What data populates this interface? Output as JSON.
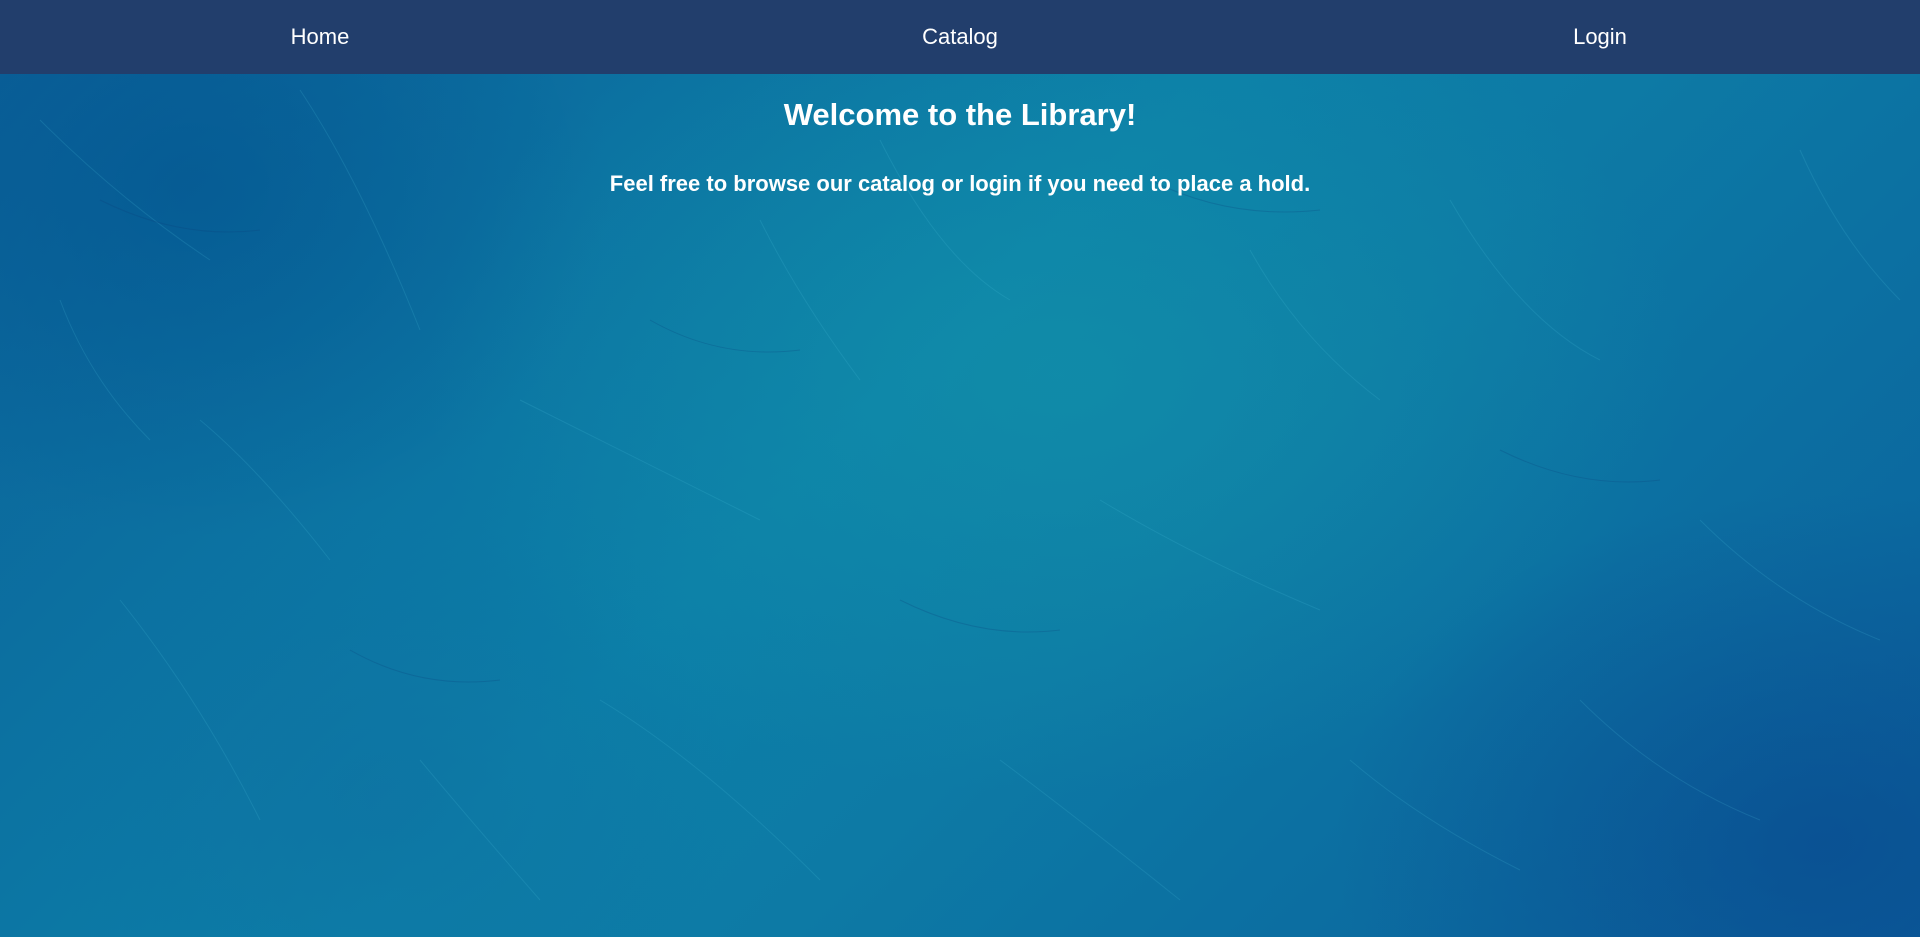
{
  "nav": {
    "items": [
      {
        "label": "Home"
      },
      {
        "label": "Catalog"
      },
      {
        "label": "Login"
      }
    ]
  },
  "main": {
    "title": "Welcome to the Library!",
    "subtitle": "Feel free to browse our catalog or login if you need to place a hold."
  },
  "colors": {
    "navbar": "#223e6c",
    "background": "#0a6b9c",
    "text": "#ffffff"
  }
}
